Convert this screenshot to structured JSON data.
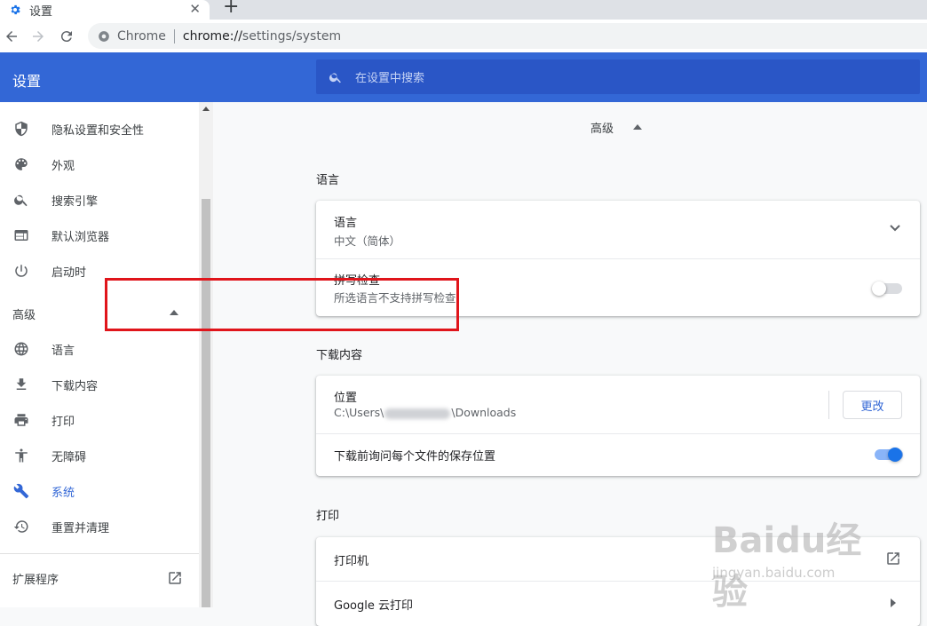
{
  "tab": {
    "title": "设置",
    "close": "✕",
    "new_tab": "+"
  },
  "toolbar": {
    "site_name": "Chrome",
    "url_scheme": "chrome://",
    "url_path": "settings/system"
  },
  "header": {
    "title": "设置",
    "search_placeholder": "在设置中搜索"
  },
  "sidebar": {
    "items_top": [
      {
        "label": "隐私设置和安全性",
        "icon": "shield-icon"
      },
      {
        "label": "外观",
        "icon": "palette-icon"
      },
      {
        "label": "搜索引擎",
        "icon": "search-icon"
      },
      {
        "label": "默认浏览器",
        "icon": "browser-icon"
      },
      {
        "label": "启动时",
        "icon": "power-icon"
      }
    ],
    "advanced_header": "高级",
    "items_advanced": [
      {
        "label": "语言",
        "icon": "globe-icon"
      },
      {
        "label": "下载内容",
        "icon": "download-icon"
      },
      {
        "label": "打印",
        "icon": "printer-icon"
      },
      {
        "label": "无障碍",
        "icon": "accessibility-icon"
      },
      {
        "label": "系统",
        "icon": "wrench-icon",
        "active": true
      },
      {
        "label": "重置并清理",
        "icon": "history-icon"
      }
    ],
    "extensions": "扩展程序"
  },
  "main": {
    "advanced_toggle": "高级",
    "language_section": {
      "title": "语言",
      "language_row": {
        "title": "语言",
        "value": "中文（简体）"
      },
      "spellcheck_row": {
        "title": "拼写检查",
        "subtitle": "所选语言不支持拼写检查",
        "enabled": false
      }
    },
    "downloads_section": {
      "title": "下载内容",
      "location_row": {
        "title": "位置",
        "path_prefix": "C:\\Users\\",
        "path_suffix": "\\Downloads",
        "button": "更改"
      },
      "ask_row": {
        "title": "下载前询问每个文件的保存位置",
        "enabled": true
      }
    },
    "print_section": {
      "title": "打印",
      "printers_row": {
        "title": "打印机"
      },
      "cloud_row": {
        "title": "Google 云打印"
      }
    }
  },
  "watermark": {
    "brand": "Baidu经验",
    "url": "jingyan.baidu.com"
  },
  "colors": {
    "accent": "#3367d6",
    "header": "#3367d6",
    "search": "#2a56c6",
    "highlight": "#e0151b"
  }
}
